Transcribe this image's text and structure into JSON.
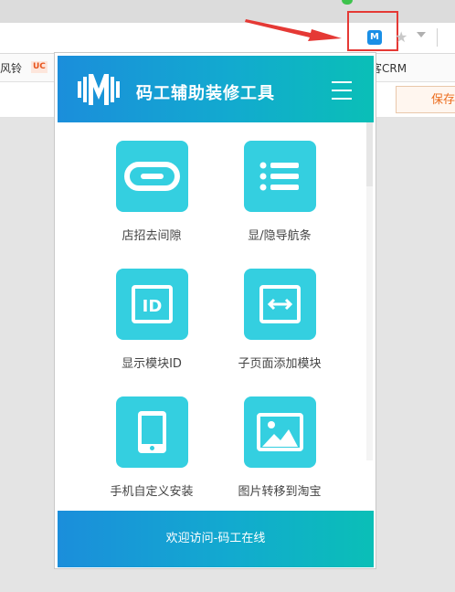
{
  "browser": {
    "bookmarks": {
      "item1": "风铃",
      "uc_badge": "UC",
      "item2": "客CRM"
    },
    "extension_icon_label": "M",
    "page_button": "保存"
  },
  "popup": {
    "title": "码工辅助装修工具",
    "tools": [
      {
        "label": "店招去间隙",
        "icon": "link-icon"
      },
      {
        "label": "显/隐导航条",
        "icon": "list-icon"
      },
      {
        "label": "显示模块ID",
        "icon": "id-card-icon"
      },
      {
        "label": "子页面添加模块",
        "icon": "horizontal-resize-icon"
      },
      {
        "label": "手机自定义安装",
        "icon": "mobile-phone-icon"
      },
      {
        "label": "图片转移到淘宝",
        "icon": "image-icon"
      }
    ],
    "footer": "欢迎访问-码工在线"
  },
  "colors": {
    "header_gradient_start": "#1b8edb",
    "header_gradient_end": "#0abfb7",
    "tile": "#34cfe0",
    "highlight_box": "#e53935",
    "save_text": "#ec6d1e"
  }
}
